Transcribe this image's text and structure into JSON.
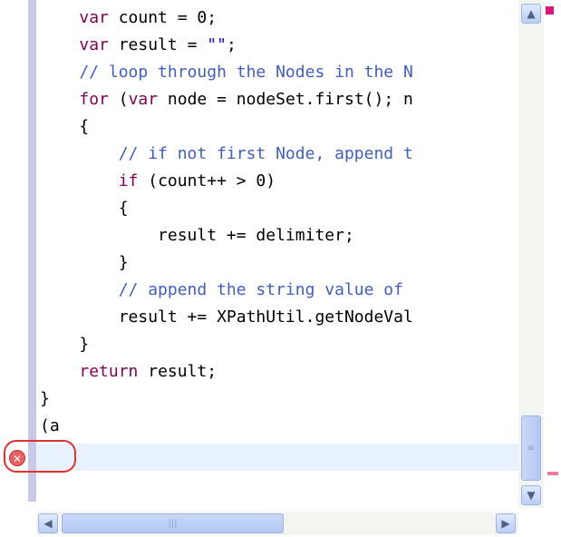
{
  "editor": {
    "lines": [
      {
        "id": "l1",
        "indent": "    ",
        "parts": [
          {
            "t": "kw",
            "v": "var"
          },
          {
            "t": "tx",
            "v": " count = 0;"
          }
        ]
      },
      {
        "id": "l2",
        "indent": "    ",
        "parts": [
          {
            "t": "kw",
            "v": "var"
          },
          {
            "t": "tx",
            "v": " result = "
          },
          {
            "t": "str",
            "v": "\"\""
          },
          {
            "t": "tx",
            "v": ";"
          }
        ]
      },
      {
        "id": "l3",
        "indent": "    ",
        "parts": [
          {
            "t": "cm",
            "v": "// loop through the Nodes in the N"
          }
        ]
      },
      {
        "id": "l4",
        "indent": "    ",
        "parts": [
          {
            "t": "kw",
            "v": "for"
          },
          {
            "t": "tx",
            "v": " ("
          },
          {
            "t": "kw",
            "v": "var"
          },
          {
            "t": "tx",
            "v": " node = nodeSet.first(); n"
          }
        ]
      },
      {
        "id": "l5",
        "indent": "    ",
        "parts": [
          {
            "t": "tx",
            "v": "{"
          }
        ]
      },
      {
        "id": "l6",
        "indent": "        ",
        "parts": [
          {
            "t": "cm",
            "v": "// if not first Node, append t"
          }
        ]
      },
      {
        "id": "l7",
        "indent": "        ",
        "parts": [
          {
            "t": "kw",
            "v": "if"
          },
          {
            "t": "tx",
            "v": " (count++ > 0)"
          }
        ]
      },
      {
        "id": "l8",
        "indent": "        ",
        "parts": [
          {
            "t": "tx",
            "v": "{"
          }
        ]
      },
      {
        "id": "l9",
        "indent": "            ",
        "parts": [
          {
            "t": "tx",
            "v": "result += delimiter;"
          }
        ]
      },
      {
        "id": "l10",
        "indent": "        ",
        "parts": [
          {
            "t": "tx",
            "v": "}"
          }
        ]
      },
      {
        "id": "l11",
        "indent": "        ",
        "parts": [
          {
            "t": "cm",
            "v": "// append the string value of"
          }
        ]
      },
      {
        "id": "l12",
        "indent": "        ",
        "parts": [
          {
            "t": "tx",
            "v": "result += XPathUtil.getNodeVal"
          }
        ]
      },
      {
        "id": "l13",
        "indent": "    ",
        "parts": [
          {
            "t": "tx",
            "v": "}"
          }
        ]
      },
      {
        "id": "l14",
        "indent": "    ",
        "parts": [
          {
            "t": "kw",
            "v": "return"
          },
          {
            "t": "tx",
            "v": " result;"
          }
        ]
      },
      {
        "id": "l15",
        "indent": "",
        "parts": [
          {
            "t": "tx",
            "v": "}"
          }
        ]
      },
      {
        "id": "l16",
        "indent": "",
        "parts": [
          {
            "t": "tx",
            "v": "(a"
          }
        ]
      },
      {
        "id": "l17",
        "indent": "",
        "parts": [
          {
            "t": "tx",
            "v": ""
          }
        ]
      }
    ]
  },
  "error_marker": {
    "icon": "error-icon",
    "glyph": "✕"
  },
  "scrollbars": {
    "up_glyph": "▲",
    "down_glyph": "▼",
    "left_glyph": "◀",
    "right_glyph": "▶",
    "grip_glyph": "≡",
    "hgrip_glyph": "|||"
  },
  "colors": {
    "keyword": "#7f0055",
    "comment": "#3f5fbf",
    "string": "#2a00ff",
    "error": "#e23030",
    "current_line": "#e8f2fe"
  }
}
